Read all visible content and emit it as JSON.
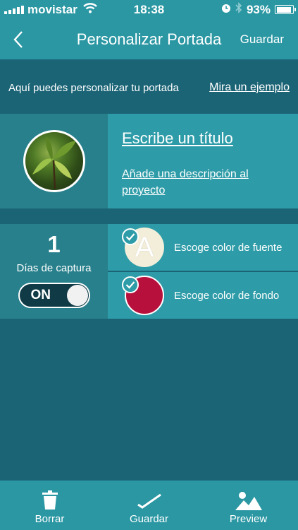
{
  "status": {
    "carrier": "movistar",
    "time": "18:38",
    "battery": "93%",
    "battery_fraction": 0.93
  },
  "nav": {
    "title": "Personalizar Portada",
    "save": "Guardar"
  },
  "intro": {
    "text": "Aquí puedes personalizar tu portada",
    "link": "Mira un ejemplo"
  },
  "project": {
    "title": "Escribe un título",
    "description": "Añade una descripción al proyecto"
  },
  "capture": {
    "days": "1",
    "label": "Días de captura",
    "toggle": "ON"
  },
  "colors": {
    "font": {
      "label": "Escoge color de fuente",
      "swatch_letter": "A",
      "color": "#f3eed9"
    },
    "background": {
      "label": "Escoge color de fondo",
      "color": "#b8103c"
    }
  },
  "tabbar": {
    "delete": "Borrar",
    "save": "Guardar",
    "preview": "Preview"
  },
  "theme": {
    "accent": "#2a97a3",
    "dark": "#1b6476"
  }
}
